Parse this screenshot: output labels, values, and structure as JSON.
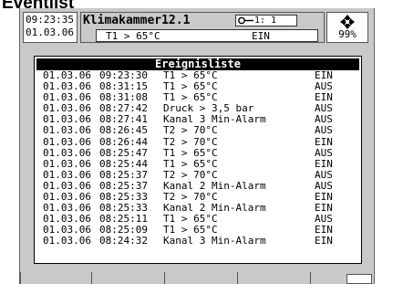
{
  "page": {
    "title": "Eventlist"
  },
  "header": {
    "time": "09:23:35",
    "date": "01.03.06",
    "chamber": "Klimakammer12.1",
    "channel": "1: 1",
    "condition": "T1 > 65°C",
    "state": "EIN",
    "percent": "99%"
  },
  "list": {
    "title": "Ereignisliste",
    "rows": [
      {
        "date": "01.03.06",
        "time": "09:23:30",
        "msg": "T1 > 65°C",
        "state": "EIN"
      },
      {
        "date": "01.03.06",
        "time": "08:31:15",
        "msg": "T1 > 65°C",
        "state": "AUS"
      },
      {
        "date": "01.03.06",
        "time": "08:31:08",
        "msg": "T1 > 65°C",
        "state": "EIN"
      },
      {
        "date": "01.03.06",
        "time": "08:27:42",
        "msg": "Druck > 3,5 bar",
        "state": "AUS"
      },
      {
        "date": "01.03.06",
        "time": "08:27:41",
        "msg": "Kanal 3 Min-Alarm",
        "state": "AUS"
      },
      {
        "date": "01.03.06",
        "time": "08:26:45",
        "msg": "T2 > 70°C",
        "state": "AUS"
      },
      {
        "date": "01.03.06",
        "time": "08:26:44",
        "msg": "T2 > 70°C",
        "state": "EIN"
      },
      {
        "date": "01.03.06",
        "time": "08:25:47",
        "msg": "T1 > 65°C",
        "state": "AUS"
      },
      {
        "date": "01.03.06",
        "time": "08:25:44",
        "msg": "T1 > 65°C",
        "state": "EIN"
      },
      {
        "date": "01.03.06",
        "time": "08:25:37",
        "msg": "T2 > 70°C",
        "state": "AUS"
      },
      {
        "date": "01.03.06",
        "time": "08:25:37",
        "msg": "Kanal 2 Min-Alarm",
        "state": "AUS"
      },
      {
        "date": "01.03.06",
        "time": "08:25:33",
        "msg": "T2 > 70°C",
        "state": "EIN"
      },
      {
        "date": "01.03.06",
        "time": "08:25:33",
        "msg": "Kanal 2 Min-Alarm",
        "state": "EIN"
      },
      {
        "date": "01.03.06",
        "time": "08:25:11",
        "msg": "T1 > 65°C",
        "state": "AUS"
      },
      {
        "date": "01.03.06",
        "time": "08:25:09",
        "msg": "T1 > 65°C",
        "state": "EIN"
      },
      {
        "date": "01.03.06",
        "time": "08:24:32",
        "msg": "Kanal 3 Min-Alarm",
        "state": "EIN"
      }
    ]
  },
  "softkeys": {
    "count": 6,
    "last_icon": "screen-icon"
  }
}
